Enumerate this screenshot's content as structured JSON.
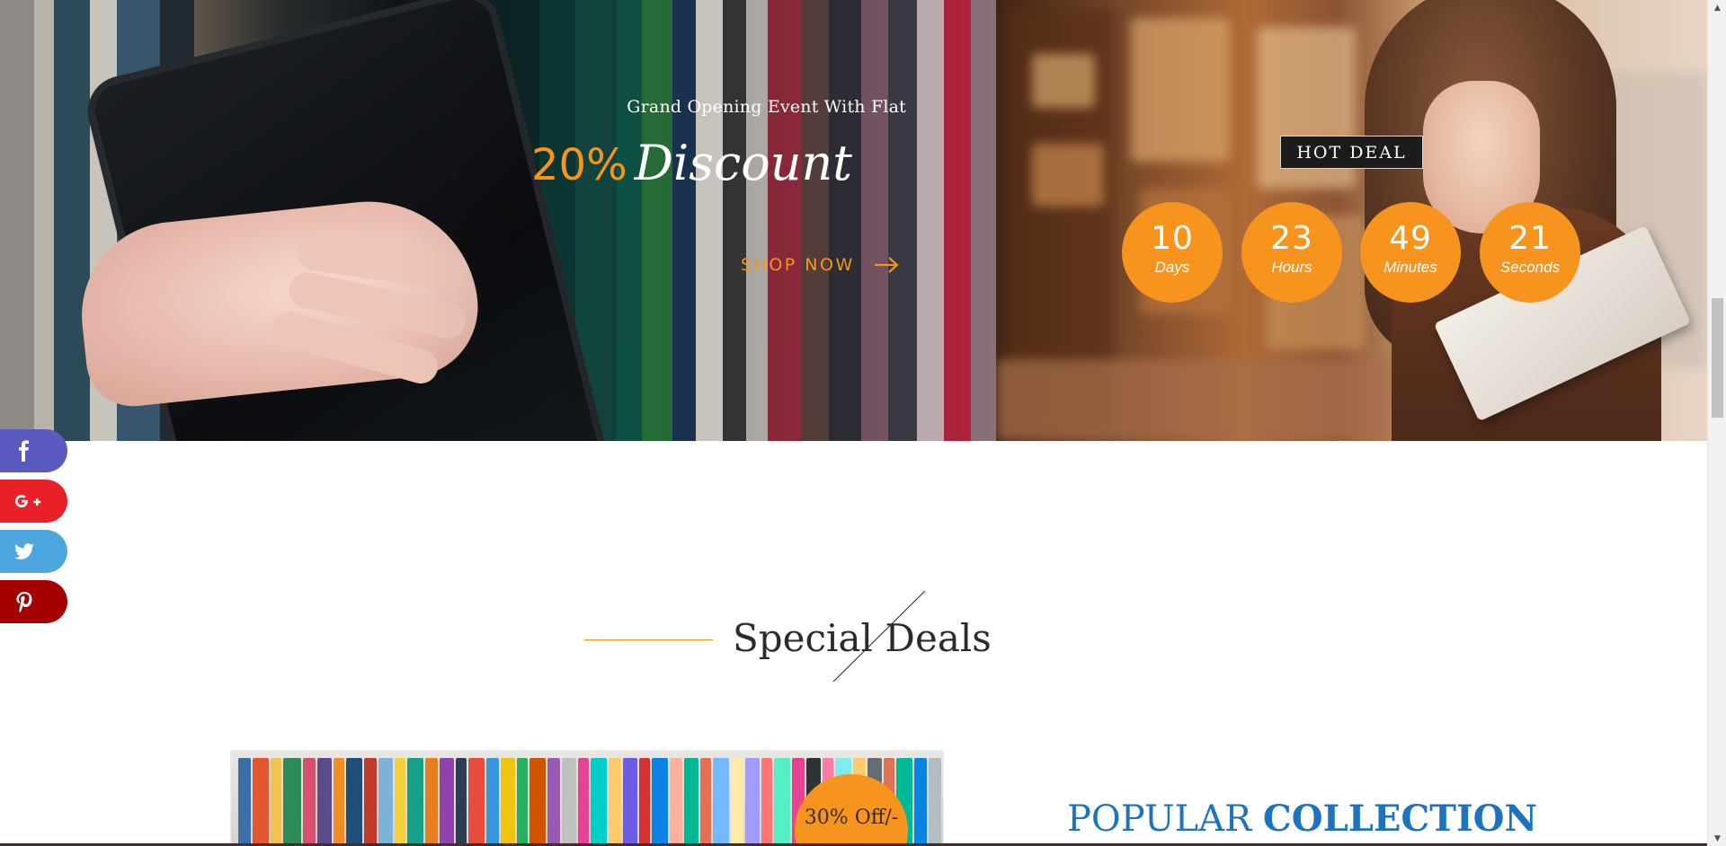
{
  "hero": {
    "promo": {
      "kicker": "Grand Opening Event With Flat",
      "percent": "20%",
      "word": "Discount",
      "cta_label": "SHOP NOW",
      "cta_icon": "arrow-right-icon"
    },
    "hot_deal": {
      "badge": "HOT DEAL",
      "countdown": [
        {
          "value": "10",
          "unit": "Days"
        },
        {
          "value": "23",
          "unit": "Hours"
        },
        {
          "value": "49",
          "unit": "Minutes"
        },
        {
          "value": "21",
          "unit": "Seconds"
        }
      ]
    }
  },
  "social": [
    {
      "network": "facebook",
      "icon": "facebook-icon",
      "color": "#5a5ac0"
    },
    {
      "network": "google-plus",
      "icon": "google-plus-icon",
      "color": "#ea2028"
    },
    {
      "network": "twitter",
      "icon": "twitter-icon",
      "color": "#4da7de"
    },
    {
      "network": "pinterest",
      "icon": "pinterest-icon",
      "color": "#a40000"
    }
  ],
  "special_deals": {
    "title": "Special Deals",
    "card_badge": "30% Off/-",
    "popular_prefix": "POPULAR",
    "popular_strong": "COLLECTION"
  },
  "colors": {
    "accent": "#f7941d",
    "popular": "#1e73be"
  }
}
